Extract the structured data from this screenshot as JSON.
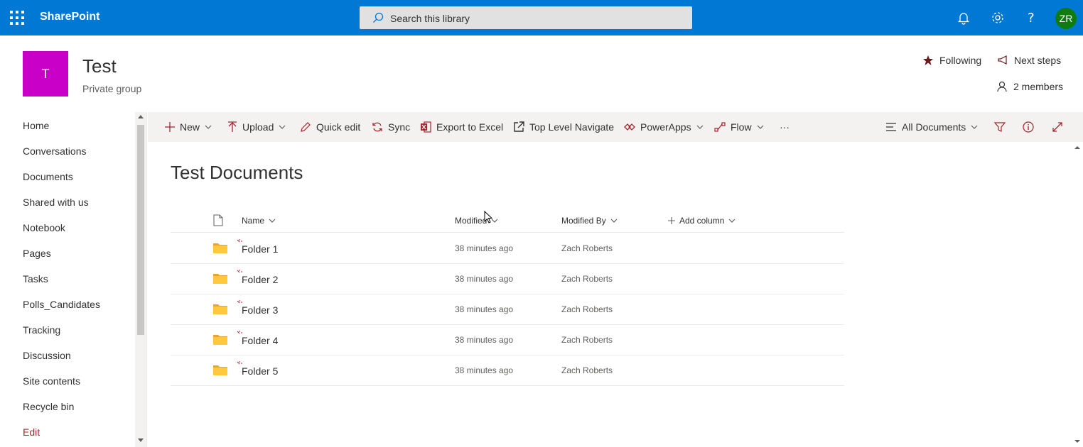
{
  "suitebar": {
    "brand": "SharePoint",
    "search_placeholder": "Search this library",
    "user_initials": "ZR",
    "colors": {
      "bar": "#0078d4",
      "avatar": "#107c10"
    }
  },
  "site": {
    "logo_letter": "T",
    "title": "Test",
    "subtitle": "Private group",
    "following_label": "Following",
    "next_steps_label": "Next steps",
    "members_label": "2 members",
    "logo_color": "#c800c8"
  },
  "nav": {
    "items": [
      {
        "label": "Home"
      },
      {
        "label": "Conversations"
      },
      {
        "label": "Documents"
      },
      {
        "label": "Shared with us"
      },
      {
        "label": "Notebook"
      },
      {
        "label": "Pages"
      },
      {
        "label": "Tasks"
      },
      {
        "label": "Polls_Candidates"
      },
      {
        "label": "Tracking"
      },
      {
        "label": "Discussion"
      },
      {
        "label": "Site contents"
      },
      {
        "label": "Recycle bin"
      },
      {
        "label": "Edit"
      }
    ]
  },
  "commandbar": {
    "new_label": "New",
    "upload_label": "Upload",
    "quick_edit_label": "Quick edit",
    "sync_label": "Sync",
    "export_label": "Export to Excel",
    "top_level_label": "Top Level Navigate",
    "powerapps_label": "PowerApps",
    "flow_label": "Flow",
    "more_label": "···",
    "view_label": "All Documents"
  },
  "library": {
    "title": "Test Documents",
    "columns": {
      "name": "Name",
      "modified": "Modified",
      "modified_by": "Modified By",
      "add_column": "Add column"
    },
    "rows": [
      {
        "name": "Folder 1",
        "modified": "38 minutes ago",
        "modified_by": "Zach Roberts"
      },
      {
        "name": "Folder 2",
        "modified": "38 minutes ago",
        "modified_by": "Zach Roberts"
      },
      {
        "name": "Folder 3",
        "modified": "38 minutes ago",
        "modified_by": "Zach Roberts"
      },
      {
        "name": "Folder 4",
        "modified": "38 minutes ago",
        "modified_by": "Zach Roberts"
      },
      {
        "name": "Folder 5",
        "modified": "38 minutes ago",
        "modified_by": "Zach Roberts"
      }
    ]
  }
}
